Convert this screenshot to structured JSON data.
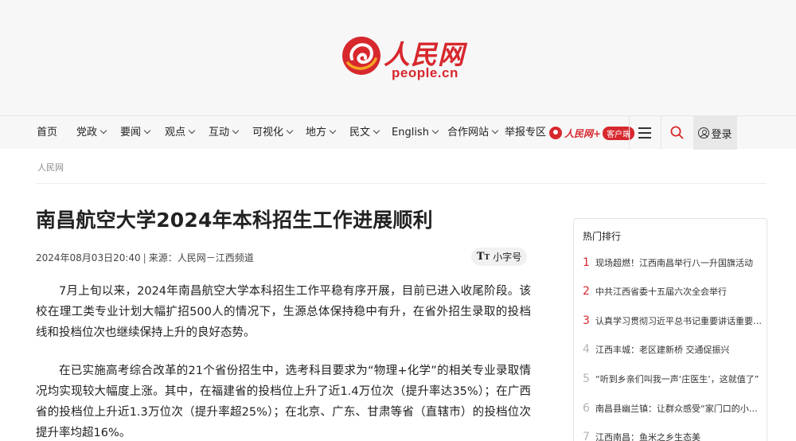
{
  "brand": {
    "logo_cn": "人民网",
    "logo_en": "people.cn",
    "accent_color": "#d7282e"
  },
  "nav": {
    "items": [
      {
        "label": "首页",
        "dropdown": false
      },
      {
        "label": "党政",
        "dropdown": true
      },
      {
        "label": "要闻",
        "dropdown": true
      },
      {
        "label": "观点",
        "dropdown": true
      },
      {
        "label": "互动",
        "dropdown": true
      },
      {
        "label": "可视化",
        "dropdown": true
      },
      {
        "label": "地方",
        "dropdown": true
      },
      {
        "label": "民文",
        "dropdown": true
      },
      {
        "label": "English",
        "dropdown": true
      },
      {
        "label": "合作网站",
        "dropdown": true
      },
      {
        "label": "举报专区",
        "dropdown": false
      }
    ],
    "client_badge": {
      "logo_text": "人民网+",
      "pill": "客户端"
    },
    "menu_icon": "hamburger-icon",
    "search_icon": "search-icon",
    "login_label": "登录"
  },
  "breadcrumb": "人民网",
  "article": {
    "title": "南昌航空大学2024年本科招生工作进展顺利",
    "date": "2024年08月03日20:40",
    "source_prefix": "来源：",
    "source": "人民网－江西频道",
    "font_toggle_label": "小字号",
    "paragraphs": [
      "7月上旬以来，2024年南昌航空大学本科招生工作平稳有序开展，目前已进入收尾阶段。该校在理工类专业计划大幅扩招500人的情况下，生源总体保持稳中有升，在省外招生录取的投档线和投档位次也继续保持上升的良好态势。",
      "在已实施高考综合改革的21个省份招生中，选考科目要求为“物理+化学”的相关专业录取情况均实现较大幅度上涨。其中，在福建省的投档位上升了近1.4万位次（提升率达35%）；在广西省的投档位上升近1.3万位次（提升率超25%）；在北京、广东、甘肃等省（直辖市）的投档位次提升率均超16%。"
    ]
  },
  "sidebar": {
    "title": "热门排行",
    "items": [
      {
        "rank": "1",
        "text": "现场超燃！江西南昌举行八一升国旗活动"
      },
      {
        "rank": "2",
        "text": "中共江西省委十五届六次全会举行"
      },
      {
        "rank": "3",
        "text": "认真学习贯彻习近平总书记重要讲话重要指示精神"
      },
      {
        "rank": "4",
        "text": "江西丰城：老区建新桥 交通促振兴"
      },
      {
        "rank": "5",
        "text": "“听到乡亲们叫我一声‘庄医生’，这就值了”"
      },
      {
        "rank": "6",
        "text": "南昌县幽兰镇：让群众感受“家门口的小幸福”"
      },
      {
        "rank": "7",
        "text": "江西南昌：鱼米之乡生态美"
      }
    ]
  }
}
